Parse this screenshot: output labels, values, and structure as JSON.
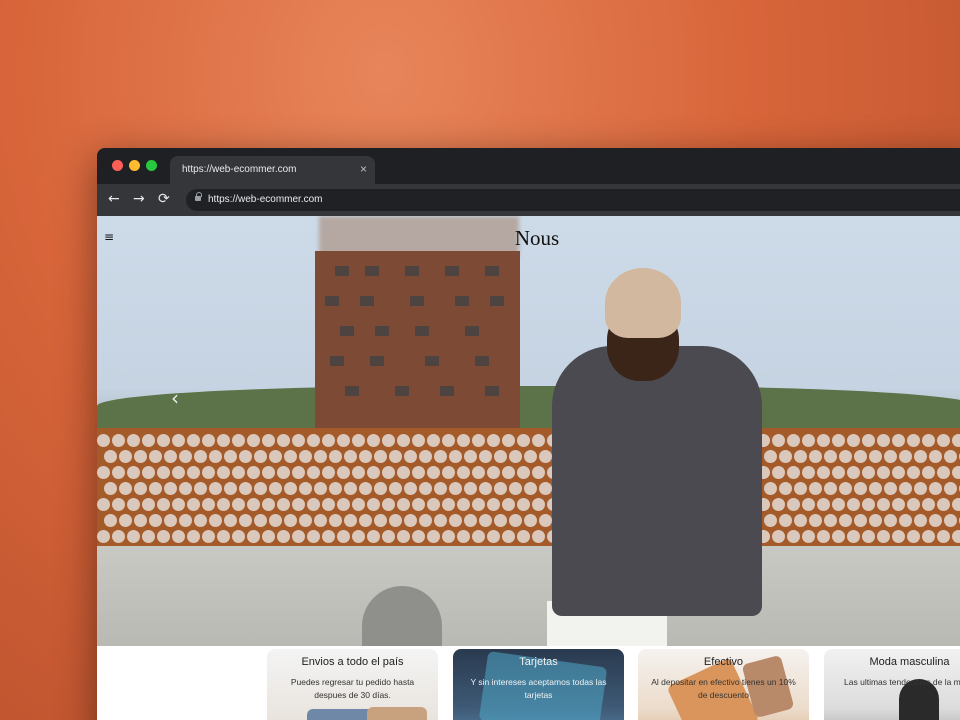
{
  "browser": {
    "tab_title": "https://web-ecommer.com",
    "tab_close": "×",
    "url": "https://web-ecommer.com",
    "back_icon": "←",
    "forward_icon": "→",
    "reload_icon": "⟳"
  },
  "site": {
    "brand": "Nous",
    "menu_icon": "≡",
    "slider_prev_icon": "‹"
  },
  "cards": [
    {
      "title": "Envios a todo el país",
      "desc": "Puedes regresar tu pedido hasta despues de 30 días."
    },
    {
      "title": "Tarjetas",
      "desc": "Y sin intereses aceptamos todas las tarjetas"
    },
    {
      "title": "Efectivo",
      "desc": "Al depositar en efectivo tienes un 10% de descuento"
    },
    {
      "title": "Moda masculina",
      "desc": "Las ultimas tendencias de la moda"
    }
  ],
  "colors": {
    "background": "#d8653a",
    "browser_chrome": "#1f2023",
    "accent": "#a55a2a"
  }
}
